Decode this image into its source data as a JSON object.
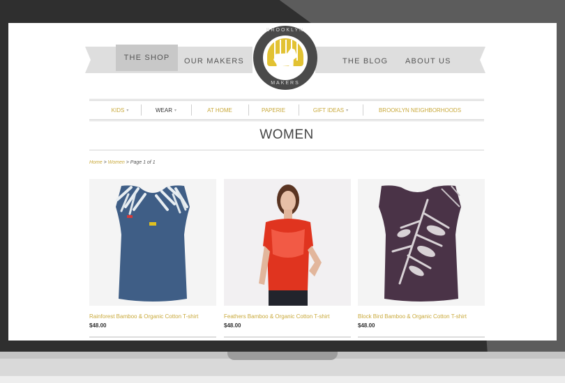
{
  "header": {
    "nav_left": [
      "THE SHOP",
      "OUR MAKERS"
    ],
    "nav_right": [
      "THE BLOG",
      "ABOUT US"
    ],
    "logo_top": "BROOKLYN",
    "logo_bottom": "MAKERS"
  },
  "nav": {
    "items": [
      {
        "label": "KIDS",
        "caret": "▾"
      },
      {
        "label": "WEAR",
        "caret": "▾"
      },
      {
        "label": "AT HOME",
        "caret": ""
      },
      {
        "label": "PAPERIE",
        "caret": ""
      },
      {
        "label": "GIFT IDEAS",
        "caret": "▾"
      },
      {
        "label": "BROOKLYN NEIGHBORHOODS",
        "caret": ""
      }
    ]
  },
  "page": {
    "title": "WOMEN"
  },
  "breadcrumb": {
    "home": "Home",
    "sep1": " > ",
    "women": "Women",
    "rest": " > Page 1 of 1"
  },
  "products": [
    {
      "name": "Rainforest Bamboo & Organic Cotton T-shirt",
      "price": "$48.00"
    },
    {
      "name": "Feathers Bamboo & Organic Cotton T-shirt",
      "price": "$48.00"
    },
    {
      "name": "Block Bird Bamboo & Organic Cotton T-shirt",
      "price": "$48.00"
    }
  ],
  "colors": {
    "accent": "#c9a93b",
    "bezel": "#2f2f2f",
    "shirt_blue": "#3f5e86",
    "shirt_red": "#e0341f",
    "shirt_purple": "#4a3347"
  }
}
